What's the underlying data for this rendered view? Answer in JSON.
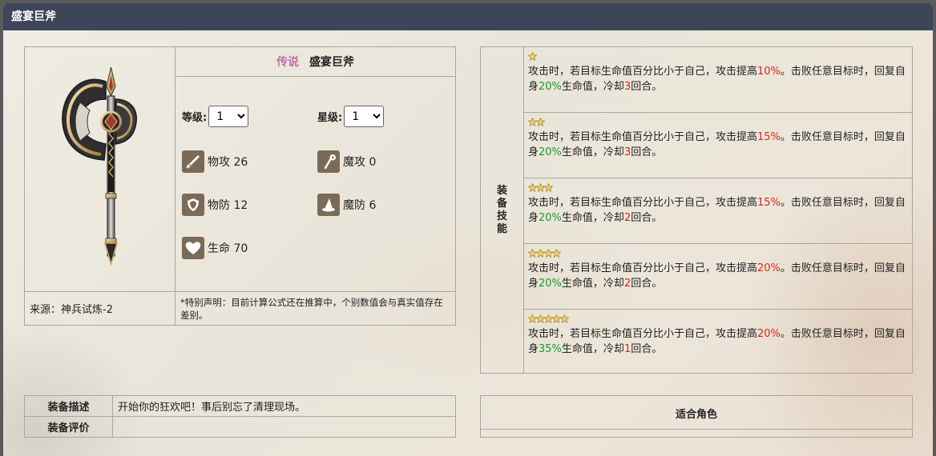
{
  "window": {
    "title": "盛宴巨斧"
  },
  "equip": {
    "rarity": "传说",
    "name": "盛宴巨斧",
    "level_label": "等级:",
    "level_value": "1",
    "star_label": "星级:",
    "star_value": "1",
    "stats": [
      {
        "label": "物攻 26",
        "icon": "sword-icon"
      },
      {
        "label": "魔攻 0",
        "icon": "wand-icon"
      },
      {
        "label": "物防 12",
        "icon": "shield-icon"
      },
      {
        "label": "魔防 6",
        "icon": "wizard-hat-icon"
      },
      {
        "label": "生命 70",
        "icon": "heart-icon"
      }
    ],
    "source": "来源：神兵试炼-2",
    "note": "*特别声明：目前计算公式还在推算中，个别数值会与真实值存在差别。"
  },
  "skills": {
    "header": [
      "装",
      "备",
      "技",
      "能"
    ],
    "rows": [
      {
        "stars": 1,
        "p1": "攻击时，若目标生命值百分比小于自己，攻击提高",
        "atk": "10%",
        "p2": "。击败任意目标时，回复自身",
        "heal": "20%",
        "p3": "生命值，冷却",
        "cd": "3",
        "p4": "回合。"
      },
      {
        "stars": 2,
        "p1": "攻击时，若目标生命值百分比小于自己，攻击提高",
        "atk": "15%",
        "p2": "。击败任意目标时，回复自身",
        "heal": "20%",
        "p3": "生命值，冷却",
        "cd": "3",
        "p4": "回合。"
      },
      {
        "stars": 3,
        "p1": "攻击时，若目标生命值百分比小于自己，攻击提高",
        "atk": "15%",
        "p2": "。击败任意目标时，回复自身",
        "heal": "20%",
        "p3": "生命值，冷却",
        "cd": "2",
        "p4": "回合。"
      },
      {
        "stars": 4,
        "p1": "攻击时，若目标生命值百分比小于自己，攻击提高",
        "atk": "20%",
        "p2": "。击败任意目标时，回复自身",
        "heal": "20%",
        "p3": "生命值，冷却",
        "cd": "2",
        "p4": "回合。"
      },
      {
        "stars": 5,
        "p1": "攻击时，若目标生命值百分比小于自己，攻击提高",
        "atk": "20%",
        "p2": "。击败任意目标时，回复自身",
        "heal": "35%",
        "p3": "生命值，冷却",
        "cd": "1",
        "p4": "回合。"
      }
    ]
  },
  "description": {
    "desc_label": "装备描述",
    "desc_value": "开始你的狂欢吧！事后别忘了清理现场。",
    "review_label": "装备评价",
    "review_value": ""
  },
  "roles": {
    "header": "适合角色"
  },
  "colors": {
    "titlebar": "#3d4659",
    "rarity": "#c06fa8",
    "red": "#e0231b",
    "green": "#1a9a2a",
    "star": "#f2d36a"
  }
}
